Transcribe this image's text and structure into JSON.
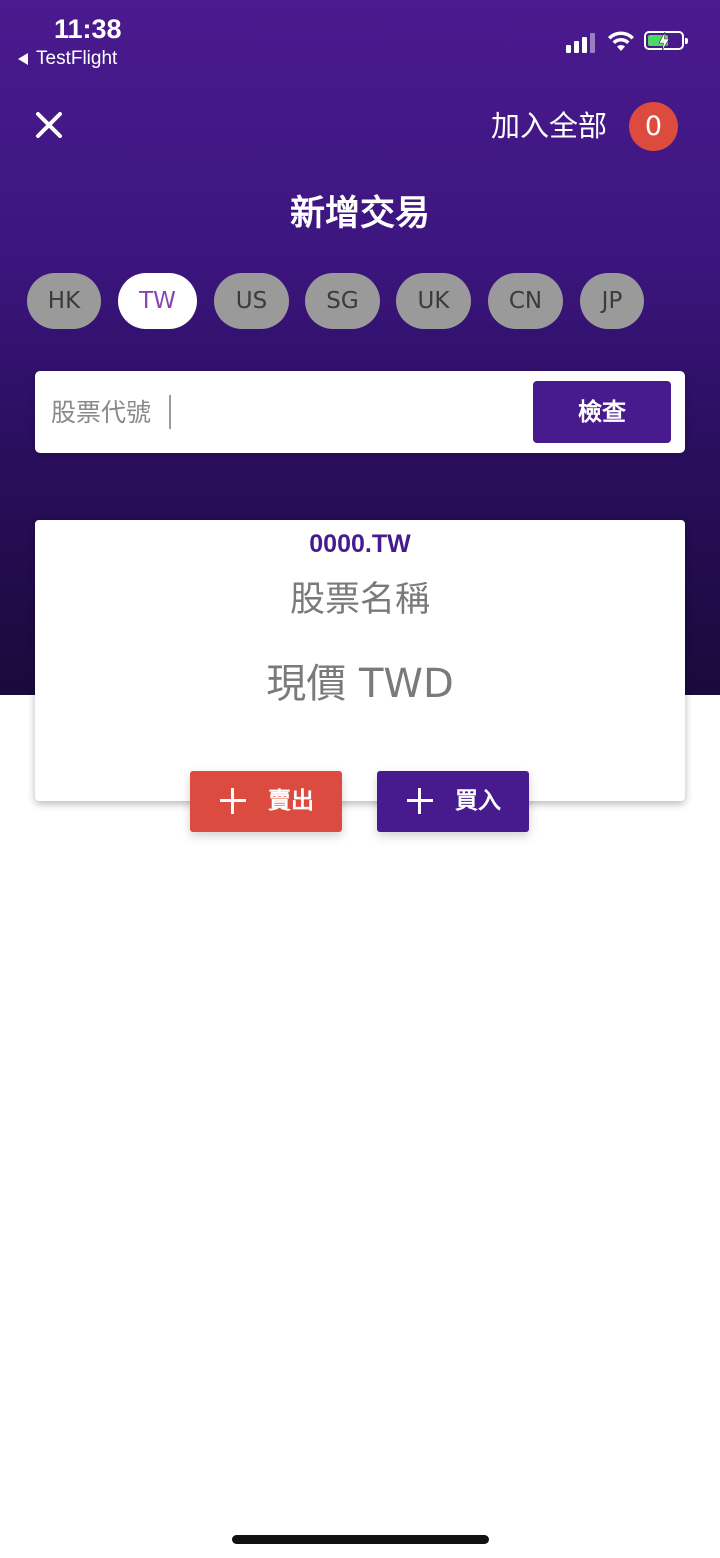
{
  "status_bar": {
    "time": "11:38",
    "back_label": "TestFlight",
    "icons": [
      "signal-icon",
      "wifi-icon",
      "battery-charging-icon"
    ]
  },
  "header": {
    "close_icon": "close-icon",
    "add_all_label": "加入全部",
    "count": "0",
    "title": "新增交易"
  },
  "markets": [
    {
      "code": "HK",
      "active": false
    },
    {
      "code": "TW",
      "active": true
    },
    {
      "code": "US",
      "active": false
    },
    {
      "code": "SG",
      "active": false
    },
    {
      "code": "UK",
      "active": false
    },
    {
      "code": "CN",
      "active": false
    },
    {
      "code": "JP",
      "active": false
    }
  ],
  "search": {
    "placeholder": "股票代號",
    "value": "",
    "button_label": "檢查"
  },
  "stock_card": {
    "code": "0000.TW",
    "name": "股票名稱",
    "price_label": "現價 TWD"
  },
  "actions": {
    "sell_label": "賣出",
    "buy_label": "買入"
  },
  "colors": {
    "primary": "#471b8d",
    "sell": "#dc4b3f",
    "badge": "#dd4b3e",
    "chip_inactive": "#9a9a9a",
    "chip_active_text": "#8a44b0"
  }
}
